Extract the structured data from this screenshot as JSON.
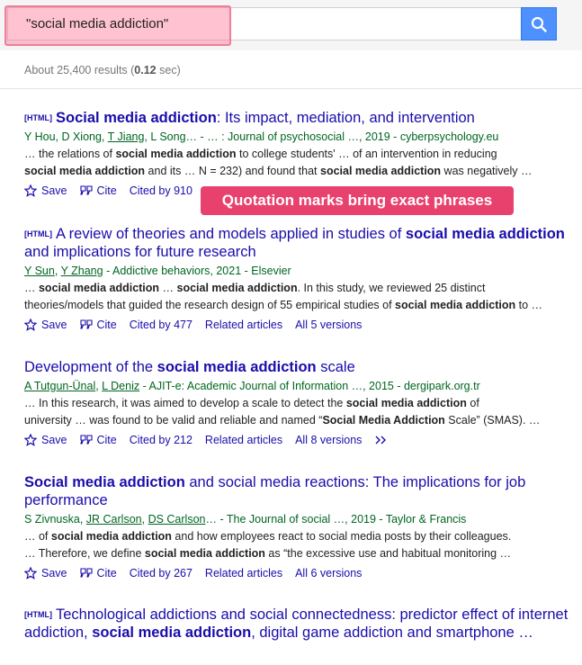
{
  "search": {
    "query": "\"social media addiction\"",
    "results_count_prefix": "About 25,400 results (",
    "results_time": "0.12",
    "results_count_suffix": " sec)"
  },
  "callout": "Quotation marks bring exact phrases",
  "colors": {
    "link": "#1a0dab",
    "green": "#006621",
    "search_button": "#4d90fe",
    "callout": "#e8416e",
    "highlight": "#f07d9a"
  },
  "results": [
    {
      "tag": "[HTML]",
      "title_parts": [
        [
          "Social media addiction",
          true
        ],
        [
          ": Its impact, mediation, and intervention",
          false
        ]
      ],
      "authors": [
        [
          "Y Hou, D Xiong, ",
          false
        ],
        [
          "T Jiang",
          true
        ],
        [
          ", L Song… - … : Journal of psychosocial …, 2019 - cyberpsychology.eu",
          false
        ]
      ],
      "snippet_lines": [
        [
          [
            "… the relations of ",
            false
          ],
          [
            "social media addiction",
            true
          ],
          [
            " to college students' … of an intervention in reducing",
            false
          ]
        ],
        [
          [
            "social media addiction",
            true
          ],
          [
            " and its … N = 232) and found that ",
            false
          ],
          [
            "social media addiction",
            true
          ],
          [
            " was negatively …",
            false
          ]
        ]
      ],
      "actions": [
        "Save",
        "Cite",
        "Cited by 910"
      ]
    },
    {
      "tag": "[HTML]",
      "title_parts": [
        [
          "A review of theories and models applied in studies of ",
          false
        ],
        [
          "social media addiction",
          true
        ],
        [
          " and implications for future research",
          false
        ]
      ],
      "authors": [
        [
          "Y Sun",
          true
        ],
        [
          ", ",
          false
        ],
        [
          "Y Zhang",
          true
        ],
        [
          " - Addictive behaviors, 2021 - Elsevier",
          false
        ]
      ],
      "snippet_lines": [
        [
          [
            "… ",
            false
          ],
          [
            "social media addiction",
            true
          ],
          [
            " … ",
            false
          ],
          [
            "social media addiction",
            true
          ],
          [
            ". In this study, we reviewed 25 distinct",
            false
          ]
        ],
        [
          [
            "theories/models that guided the research design of 55 empirical studies of ",
            false
          ],
          [
            "social media addiction",
            true
          ],
          [
            " to …",
            false
          ]
        ]
      ],
      "actions": [
        "Save",
        "Cite",
        "Cited by 477",
        "Related articles",
        "All 5 versions"
      ]
    },
    {
      "tag": "",
      "title_parts": [
        [
          "Development of the ",
          false
        ],
        [
          "social media addiction",
          true
        ],
        [
          " scale",
          false
        ]
      ],
      "authors": [
        [
          "A Tutgun-Ünal",
          true
        ],
        [
          ", ",
          false
        ],
        [
          "L Deniz",
          true
        ],
        [
          " - AJIT-e: Academic Journal of Information …, 2015 - dergipark.org.tr",
          false
        ]
      ],
      "snippet_lines": [
        [
          [
            "… In this research, it was aimed to develop a scale to detect the ",
            false
          ],
          [
            "social media addiction",
            true
          ],
          [
            " of",
            false
          ]
        ],
        [
          [
            "university … was found to be valid and reliable and named “",
            false
          ],
          [
            "Social Media Addiction",
            true
          ],
          [
            " Scale” (SMAS). …",
            false
          ]
        ]
      ],
      "actions": [
        "Save",
        "Cite",
        "Cited by 212",
        "Related articles",
        "All 8 versions"
      ]
    },
    {
      "tag": "",
      "title_parts": [
        [
          "Social media addiction",
          true
        ],
        [
          " and social media reactions: The implications for job performance",
          false
        ]
      ],
      "authors": [
        [
          "S Zivnuska, ",
          false
        ],
        [
          "JR Carlson",
          true
        ],
        [
          ", ",
          false
        ],
        [
          "DS Carlson",
          true
        ],
        [
          "… - The Journal of social …, 2019 - Taylor & Francis",
          false
        ]
      ],
      "snippet_lines": [
        [
          [
            "… of ",
            false
          ],
          [
            "social media addiction",
            true
          ],
          [
            " and how employees react to social media posts by their colleagues.",
            false
          ]
        ],
        [
          [
            "… Therefore, we define ",
            false
          ],
          [
            "social media addiction",
            true
          ],
          [
            " as “the excessive use and habitual monitoring …",
            false
          ]
        ]
      ],
      "actions": [
        "Save",
        "Cite",
        "Cited by 267",
        "Related articles",
        "All 6 versions"
      ]
    },
    {
      "tag": "[HTML]",
      "title_parts": [
        [
          "Technological addictions and social connectedness: predictor effect of internet addiction, ",
          false
        ],
        [
          "social media addiction",
          true
        ],
        [
          ", digital game addiction and smartphone …",
          false
        ]
      ],
      "authors": [],
      "snippet_lines": [],
      "actions": []
    }
  ]
}
